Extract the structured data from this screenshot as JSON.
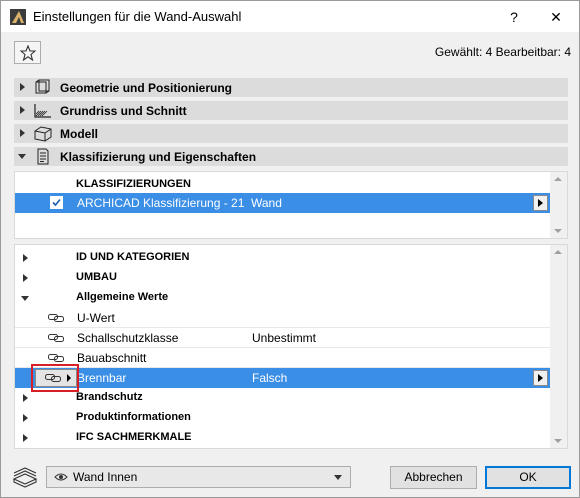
{
  "window": {
    "title": "Einstellungen für die Wand-Auswahl",
    "help_label": "?",
    "close_label": "✕"
  },
  "selection_info": "Gewählt: 4 Bearbeitbar: 4",
  "panels": [
    {
      "label": "Geometrie und Positionierung",
      "icon": "geometry-icon",
      "expanded": false
    },
    {
      "label": "Grundriss und Schnitt",
      "icon": "floorplan-icon",
      "expanded": false
    },
    {
      "label": "Modell",
      "icon": "model-icon",
      "expanded": false
    },
    {
      "label": "Klassifizierung und Eigenschaften",
      "icon": "classification-icon",
      "expanded": true
    }
  ],
  "classification": {
    "header": "KLASSIFIZIERUNGEN",
    "row": {
      "name": "ARCHICAD Klassifizierung - 21",
      "value": "Wand",
      "checked": true
    }
  },
  "properties": {
    "groups_top": [
      {
        "label": "ID UND KATEGORIEN",
        "expanded": false
      },
      {
        "label": "UMBAU",
        "expanded": false
      },
      {
        "label": "Allgemeine Werte",
        "expanded": true
      }
    ],
    "items": [
      {
        "name": "U-Wert",
        "value": ""
      },
      {
        "name": "Schallschutzklasse",
        "value": "Unbestimmt"
      },
      {
        "name": "Bauabschnitt",
        "value": ""
      },
      {
        "name": "Brennbar",
        "value": "Falsch",
        "selected": true
      }
    ],
    "groups_bottom": [
      {
        "label": "Brandschutz",
        "expanded": false
      },
      {
        "label": "Produktinformationen",
        "expanded": false
      },
      {
        "label": "IFC SACHMERKMALE",
        "expanded": false
      }
    ]
  },
  "footer": {
    "favorite": "Wand Innen",
    "cancel_label": "Abbrechen",
    "ok_label": "OK"
  },
  "colors": {
    "selection": "#3a8ee6",
    "highlight_border": "#d61f26"
  }
}
